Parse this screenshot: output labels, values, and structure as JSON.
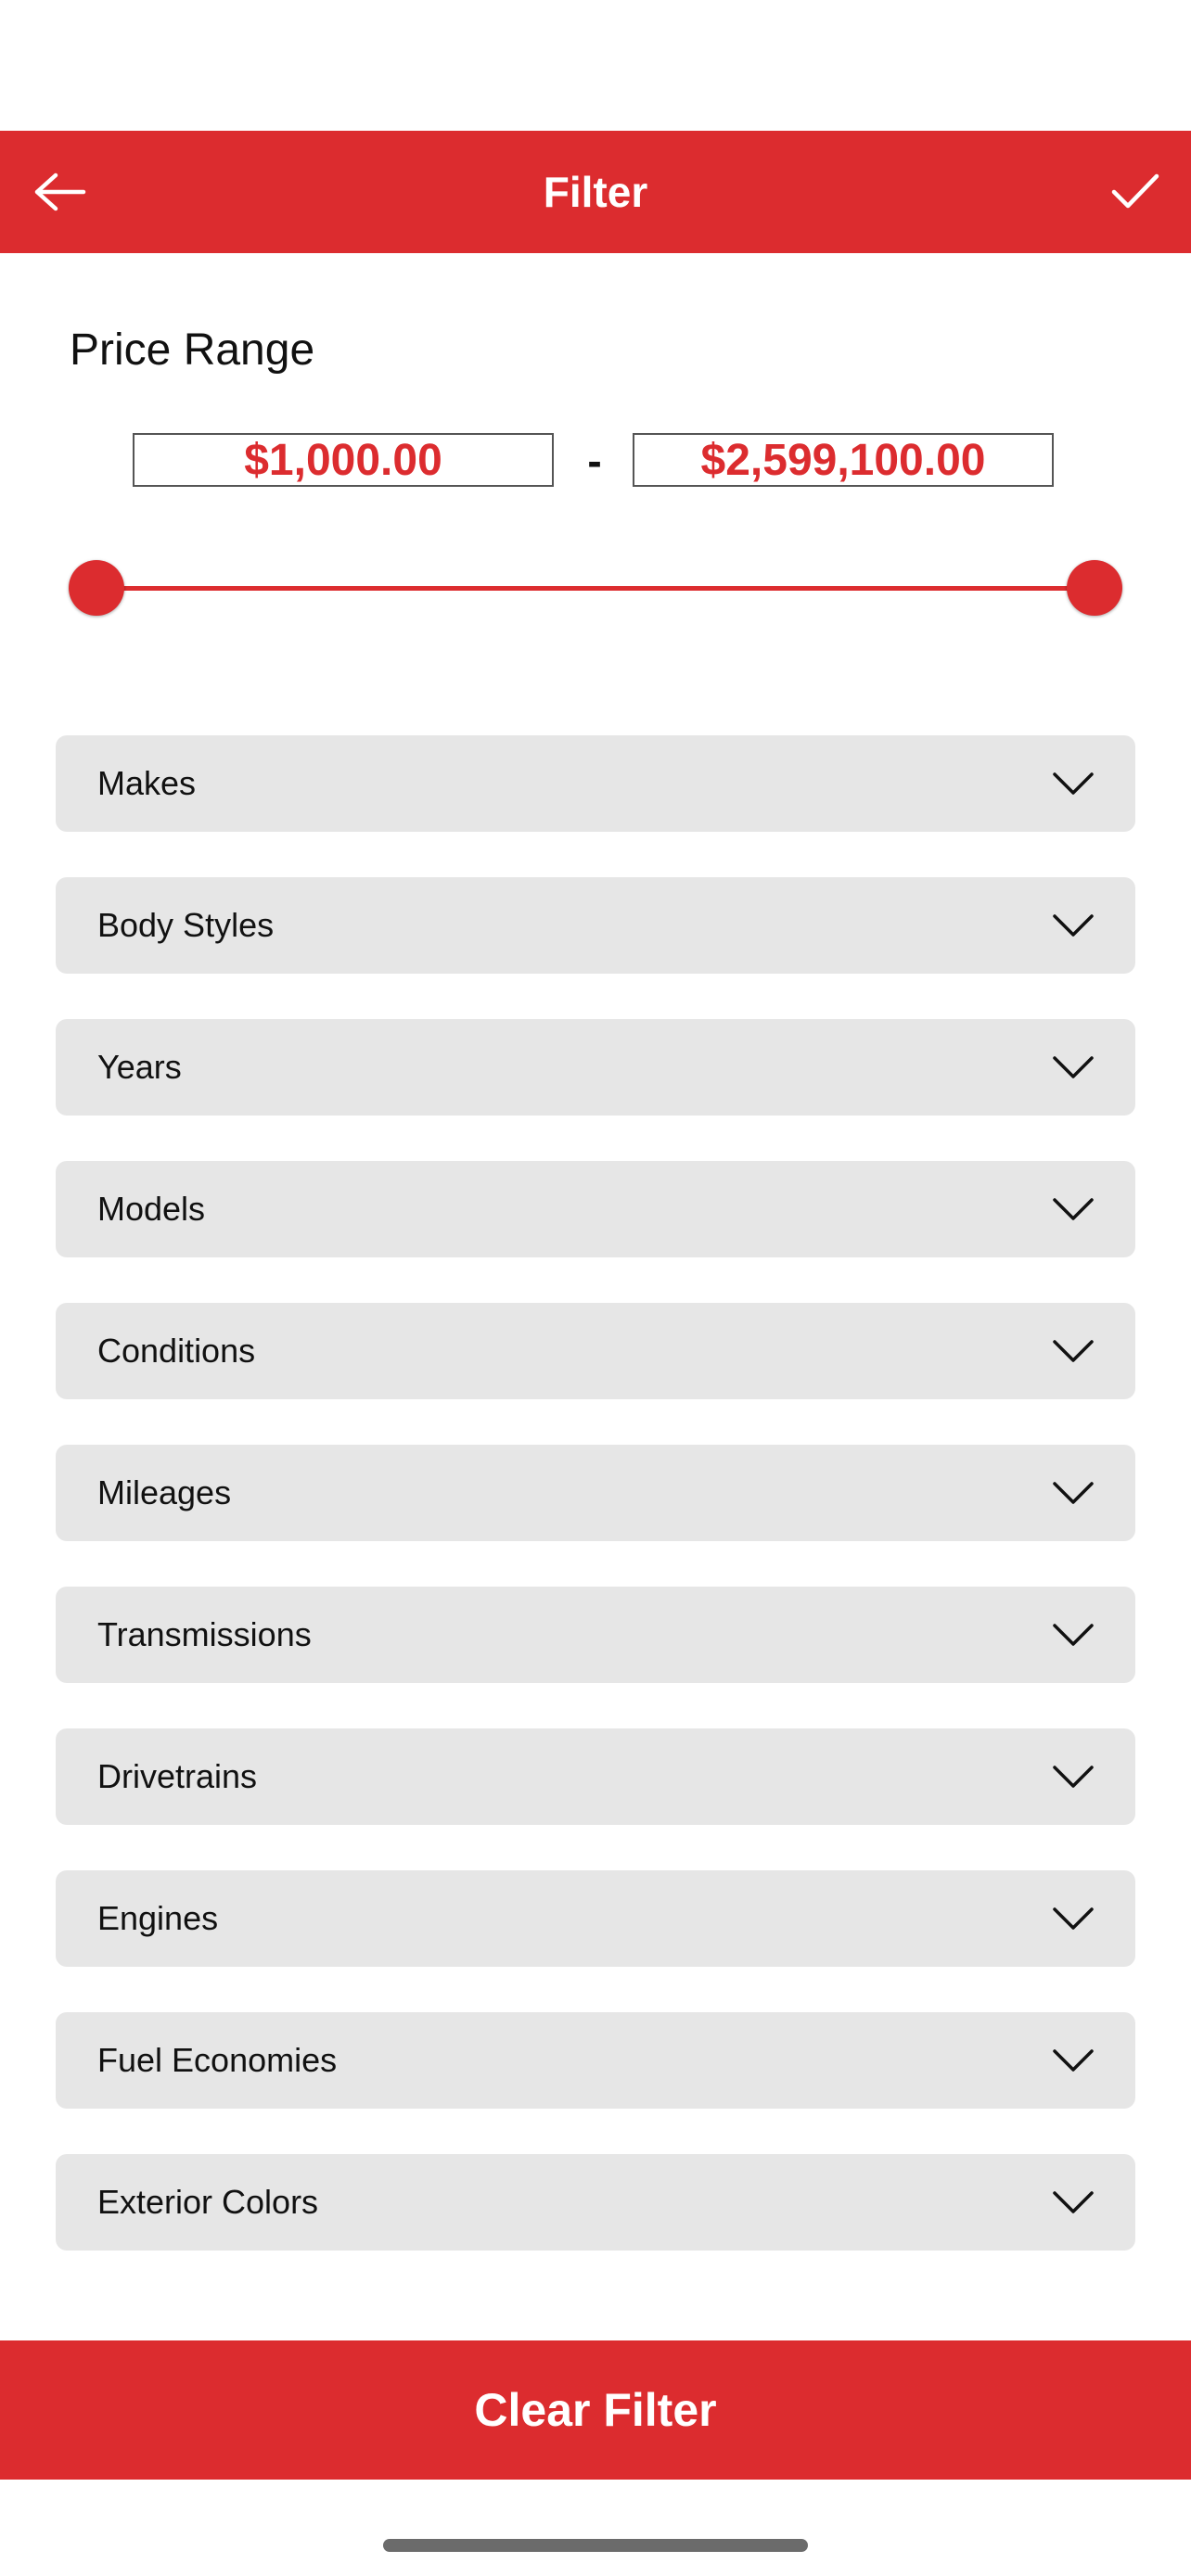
{
  "colors": {
    "accent": "#dc2c2f",
    "row_background": "#e6e6e6"
  },
  "header": {
    "title": "Filter",
    "back_icon": "arrow-left-icon",
    "confirm_icon": "checkmark-icon"
  },
  "price_range": {
    "label": "Price Range",
    "min_value": "$1,000.00",
    "max_value": "$2,599,100.00",
    "separator": "-",
    "slider": {
      "min_position": 0,
      "max_position": 1
    }
  },
  "filters": [
    {
      "label": "Makes",
      "icon": "chevron-down-icon"
    },
    {
      "label": "Body Styles",
      "icon": "chevron-down-icon"
    },
    {
      "label": "Years",
      "icon": "chevron-down-icon"
    },
    {
      "label": "Models",
      "icon": "chevron-down-icon"
    },
    {
      "label": "Conditions",
      "icon": "chevron-down-icon"
    },
    {
      "label": "Mileages",
      "icon": "chevron-down-icon"
    },
    {
      "label": "Transmissions",
      "icon": "chevron-down-icon"
    },
    {
      "label": "Drivetrains",
      "icon": "chevron-down-icon"
    },
    {
      "label": "Engines",
      "icon": "chevron-down-icon"
    },
    {
      "label": "Fuel Economies",
      "icon": "chevron-down-icon"
    },
    {
      "label": "Exterior Colors",
      "icon": "chevron-down-icon"
    }
  ],
  "footer": {
    "clear_label": "Clear Filter"
  }
}
